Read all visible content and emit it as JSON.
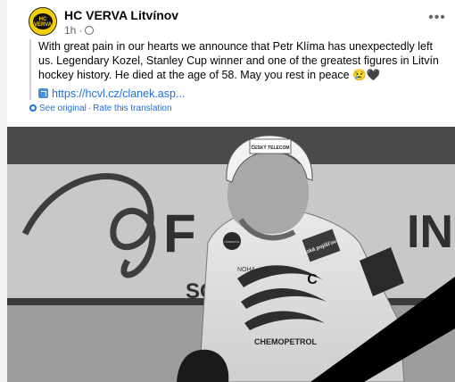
{
  "post": {
    "page_name": "HC VERVA Litvínov",
    "timestamp": "1h",
    "visibility_icon": "globe-icon",
    "more_icon": "more-options-icon",
    "logo_text": "HC VERVA",
    "text": "With great pain in our hearts we announce that Petr Klíma has unexpectedly left us. Legendary Kozel, Stanley Cup winner and one of the greatest figures in Litvín hockey history. He died at the age of 58. May you rest in peace 😢🖤",
    "link": "https://hcvl.cz/clanek.asp...",
    "see_original": "See original",
    "rate_translation": "Rate this translation"
  },
  "photo": {
    "helmet_sponsor": "ČESKÝ TELECOM",
    "jersey_sponsor_1": "česká pojišťovna",
    "jersey_sponsor_2": "CHEMOPETROL",
    "captain_letter": "C",
    "badge_text": "UNIPETROL",
    "board_text": "F",
    "board_text_2": "SO",
    "board_text_3": "IN",
    "monogram": "NOHA"
  }
}
